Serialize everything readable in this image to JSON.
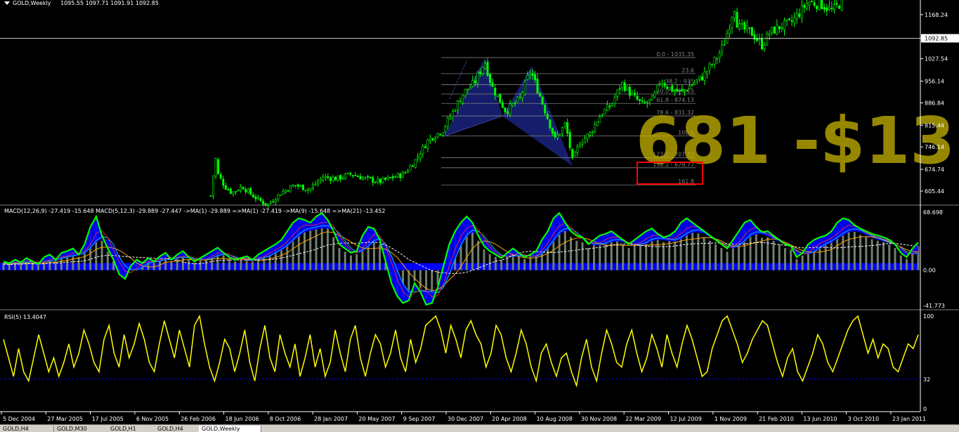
{
  "chart_header": {
    "title": "GOLD,Weekly",
    "ohlc": "1095.55 1097.71 1091.91 1092.85"
  },
  "watermark_text": "681 -$13",
  "colors": {
    "background": "#000000",
    "candle": "#00ff00",
    "fib": "#808080",
    "pattern_fill": "#1a237e",
    "macd_hist_pos": "#708070",
    "macd_fill_blue": "#0000ff",
    "macd_fill_outline": "#00ff00",
    "rsi": "#ffff00",
    "highlight_box": "#ff0000",
    "watermark": "#c8b400"
  },
  "chart_data": [
    {
      "type": "candlestick",
      "panel": "price",
      "title": "GOLD,Weekly",
      "ylim": [
        565,
        1215
      ],
      "y_ticks": [
        "1168.24",
        "1092.85",
        "1027.54",
        "956.14",
        "886.84",
        "815.44",
        "746.14",
        "674.74",
        "605.44"
      ],
      "current_price_label": "1092.85",
      "x_dates": [
        "5 Dec 2004",
        "27 Mar 2005",
        "17 Jul 2005",
        "6 Nov 2005",
        "26 Feb 2006",
        "18 Jun 2006",
        "8 Oct 2006",
        "28 Jan 2007",
        "20 May 2007",
        "9 Sep 2007",
        "30 Dec 2007",
        "20 Apr 2008",
        "10 Aug 2008",
        "30 Nov 2008",
        "22 Mar 2009",
        "12 Jul 2009",
        "1 Nov 2009",
        "21 Feb 2010",
        "13 Jun 2010",
        "3 Oct 2010",
        "23 Jan 2011"
      ],
      "close_path": [
        [
          300,
          590
        ],
        [
          303,
          640
        ],
        [
          306,
          725
        ],
        [
          310,
          660
        ],
        [
          315,
          640
        ],
        [
          320,
          620
        ],
        [
          330,
          600
        ],
        [
          345,
          620
        ],
        [
          360,
          590
        ],
        [
          380,
          560
        ],
        [
          400,
          600
        ],
        [
          420,
          625
        ],
        [
          440,
          610
        ],
        [
          460,
          650
        ],
        [
          480,
          645
        ],
        [
          500,
          660
        ],
        [
          520,
          645
        ],
        [
          540,
          635
        ],
        [
          560,
          650
        ],
        [
          575,
          660
        ],
        [
          590,
          700
        ],
        [
          610,
          770
        ],
        [
          630,
          800
        ],
        [
          645,
          860
        ],
        [
          660,
          920
        ],
        [
          675,
          950
        ],
        [
          690,
          1020
        ],
        [
          700,
          940
        ],
        [
          720,
          860
        ],
        [
          740,
          900
        ],
        [
          755,
          990
        ],
        [
          770,
          900
        ],
        [
          790,
          770
        ],
        [
          805,
          820
        ],
        [
          815,
          700
        ],
        [
          825,
          760
        ],
        [
          840,
          790
        ],
        [
          855,
          850
        ],
        [
          870,
          880
        ],
        [
          885,
          950
        ],
        [
          900,
          910
        ],
        [
          915,
          880
        ],
        [
          930,
          900
        ],
        [
          940,
          960
        ],
        [
          955,
          930
        ],
        [
          970,
          920
        ],
        [
          990,
          955
        ],
        [
          1000,
          970
        ],
        [
          1010,
          1000
        ],
        [
          1020,
          1030
        ],
        [
          1030,
          1070
        ],
        [
          1040,
          1150
        ],
        [
          1045,
          1200
        ],
        [
          1050,
          1130
        ],
        [
          1060,
          1120
        ],
        [
          1070,
          1110
        ],
        [
          1085,
          1070
        ],
        [
          1095,
          1110
        ],
        [
          1110,
          1130
        ],
        [
          1125,
          1140
        ],
        [
          1140,
          1180
        ],
        [
          1150,
          1210
        ],
        [
          1170,
          1200
        ],
        [
          1185,
          1180
        ],
        [
          1200,
          1215
        ]
      ],
      "fib_levels": [
        {
          "label": "0.0 - 1031.35",
          "y": 1031.35
        },
        {
          "label": "23.6",
          "y": 980
        },
        {
          "label": "38.2 - 935",
          "y": 945
        },
        {
          "label": "50.0 - 904.15",
          "y": 915
        },
        {
          "label": "61.8 - 874.13",
          "y": 885
        },
        {
          "label": "78.6 - 831.32",
          "y": 845
        },
        {
          "label": "100.0",
          "y": 781
        },
        {
          "label": "127.2 - 707.83",
          "y": 712
        },
        {
          "label": "138.2 - 679.77",
          "y": 679.77
        },
        {
          "label": "161.8",
          "y": 625
        }
      ]
    },
    {
      "type": "histogram+line",
      "panel": "macd",
      "title": "MACD(12,26,9) -27.419 -15.648 MACD(5,12,3) -29.889 -27.447 ->MA(1) -29.889 =>MA(1) -27.419 ->MA(9) -15.648 =>MA(21) -13.452",
      "ylim": [
        -41.773,
        68.698
      ],
      "y_ticks": [
        "68.698",
        "0.00",
        "-41.773"
      ],
      "values": [
        10,
        8,
        12,
        9,
        14,
        10,
        7,
        15,
        18,
        12,
        20,
        22,
        25,
        18,
        30,
        50,
        62,
        40,
        25,
        12,
        -5,
        -10,
        5,
        12,
        8,
        14,
        10,
        16,
        20,
        12,
        18,
        22,
        15,
        10,
        14,
        18,
        22,
        26,
        20,
        15,
        12,
        14,
        16,
        12,
        18,
        22,
        26,
        30,
        35,
        45,
        55,
        60,
        58,
        55,
        62,
        66,
        58,
        45,
        30,
        25,
        20,
        22,
        40,
        50,
        48,
        35,
        10,
        -15,
        -30,
        -38,
        -35,
        -15,
        -25,
        -40,
        -38,
        -20,
        5,
        30,
        45,
        55,
        62,
        55,
        40,
        28,
        22,
        18,
        14,
        20,
        25,
        20,
        15,
        18,
        22,
        35,
        45,
        60,
        66,
        55,
        45,
        40,
        38,
        30,
        35,
        40,
        42,
        45,
        40,
        35,
        30,
        35,
        40,
        45,
        48,
        42,
        38,
        40,
        45,
        55,
        60,
        55,
        50,
        45,
        40,
        35,
        30,
        25,
        35,
        45,
        55,
        58,
        50,
        44,
        45,
        40,
        35,
        30,
        28,
        15,
        20,
        30,
        35,
        38,
        40,
        45,
        55,
        60,
        58,
        52,
        48,
        45,
        42,
        40,
        38,
        35,
        30,
        20,
        15,
        25,
        32
      ]
    },
    {
      "type": "line",
      "panel": "rsi",
      "title": "RSI(5) 13.4047",
      "ylim": [
        0,
        100
      ],
      "y_ticks": [
        "100",
        "32",
        "0"
      ],
      "reference_line": 32,
      "values": [
        75,
        55,
        35,
        65,
        40,
        30,
        55,
        80,
        60,
        40,
        55,
        35,
        50,
        70,
        45,
        60,
        85,
        70,
        50,
        40,
        75,
        90,
        60,
        45,
        80,
        55,
        70,
        92,
        75,
        50,
        40,
        70,
        95,
        75,
        55,
        85,
        65,
        45,
        90,
        100,
        70,
        45,
        30,
        50,
        75,
        65,
        40,
        60,
        85,
        50,
        30,
        65,
        90,
        55,
        40,
        80,
        60,
        45,
        70,
        35,
        55,
        80,
        45,
        65,
        35,
        50,
        85,
        60,
        40,
        75,
        90,
        55,
        35,
        60,
        80,
        70,
        45,
        60,
        85,
        55,
        40,
        75,
        50,
        65,
        90,
        95,
        100,
        85,
        60,
        90,
        75,
        55,
        85,
        95,
        80,
        70,
        45,
        60,
        90,
        80,
        55,
        40,
        60,
        85,
        70,
        45,
        30,
        60,
        70,
        50,
        35,
        55,
        60,
        40,
        25,
        55,
        75,
        45,
        30,
        60,
        85,
        70,
        50,
        45,
        70,
        85,
        60,
        40,
        55,
        80,
        65,
        45,
        80,
        60,
        45,
        70,
        90,
        75,
        55,
        35,
        40,
        65,
        80,
        95,
        100,
        85,
        70,
        50,
        60,
        75,
        85,
        95,
        90,
        70,
        50,
        35,
        55,
        65,
        40,
        30,
        45,
        60,
        80,
        70,
        50,
        40,
        55,
        70,
        85,
        95,
        100,
        80,
        60,
        75,
        55,
        70,
        65,
        45,
        40,
        55,
        70,
        65,
        80
      ]
    }
  ],
  "tabs": [
    {
      "label": "GOLD,H4"
    },
    {
      "label": "GOLD,M30"
    },
    {
      "label": "GOLD,H1"
    },
    {
      "label": "GOLD,H4"
    },
    {
      "label": "GOLD,Weekly"
    }
  ]
}
